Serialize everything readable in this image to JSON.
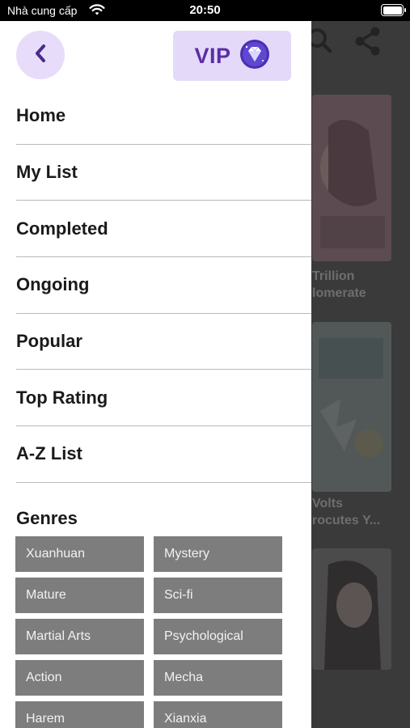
{
  "status_bar": {
    "carrier": "Nhà cung cấp",
    "time": "20:50",
    "icons": [
      "wifi-icon",
      "battery-icon"
    ]
  },
  "background": {
    "header_icons": [
      "search-icon",
      "share-icon"
    ],
    "titles": [
      {
        "line1": "Trillion",
        "line2": "lomerate"
      },
      {
        "line1": "Volts",
        "line2": "rocutes Y..."
      }
    ]
  },
  "drawer": {
    "back_icon": "chevron-left-icon",
    "vip": {
      "label": "VIP",
      "icon": "diamond-icon"
    },
    "menu": [
      {
        "label": "Home"
      },
      {
        "label": "My List"
      },
      {
        "label": "Completed"
      },
      {
        "label": "Ongoing"
      },
      {
        "label": "Popular"
      },
      {
        "label": "Top Rating"
      },
      {
        "label": "A-Z List"
      }
    ],
    "genres_title": "Genres",
    "genres": [
      {
        "label": "Xuanhuan"
      },
      {
        "label": "Mystery"
      },
      {
        "label": "Mature"
      },
      {
        "label": "Sci-fi"
      },
      {
        "label": "Martial Arts"
      },
      {
        "label": "Psychological"
      },
      {
        "label": "Action"
      },
      {
        "label": "Mecha"
      },
      {
        "label": "Harem"
      },
      {
        "label": "Xianxia"
      }
    ]
  },
  "colors": {
    "accent": "#5a2fa5",
    "accent_light": "#e5d9fa",
    "chip": "#7d7d7d"
  }
}
